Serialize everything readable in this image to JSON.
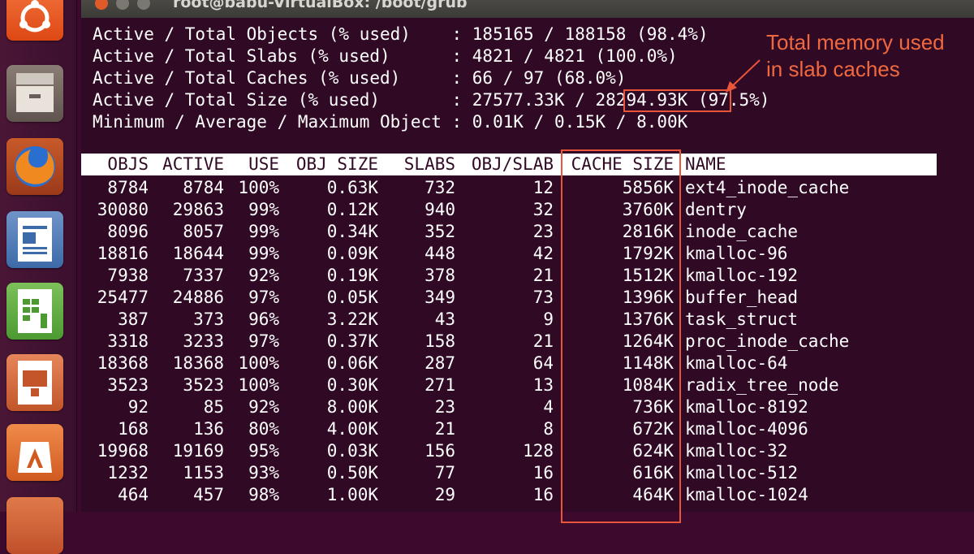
{
  "window": {
    "title": "root@babu-VirtualBox: /boot/grub"
  },
  "launcher": {
    "items": [
      {
        "name": "ubuntu-dash-icon"
      },
      {
        "name": "files-icon"
      },
      {
        "name": "firefox-icon"
      },
      {
        "name": "libreoffice-writer-icon"
      },
      {
        "name": "libreoffice-calc-icon"
      },
      {
        "name": "libreoffice-impress-icon"
      },
      {
        "name": "software-center-icon"
      },
      {
        "name": "launcher-item-icon"
      }
    ]
  },
  "summary": [
    "Active / Total Objects (% used)    : 185165 / 188158 (98.4%)",
    "Active / Total Slabs (% used)      : 4821 / 4821 (100.0%)",
    "Active / Total Caches (% used)     : 66 / 97 (68.0%)",
    "Active / Total Size (% used)       : 27577.33K / 28294.93K (97.5%)",
    "Minimum / Average / Maximum Object : 0.01K / 0.15K / 8.00K"
  ],
  "table": {
    "columns": [
      "OBJS",
      "ACTIVE",
      "USE",
      "OBJ SIZE",
      "SLABS",
      "OBJ/SLAB",
      "CACHE SIZE",
      "NAME"
    ],
    "rows": [
      [
        "8784",
        "8784",
        "100%",
        "0.63K",
        "732",
        "12",
        "5856K",
        "ext4_inode_cache"
      ],
      [
        "30080",
        "29863",
        "99%",
        "0.12K",
        "940",
        "32",
        "3760K",
        "dentry"
      ],
      [
        "8096",
        "8057",
        "99%",
        "0.34K",
        "352",
        "23",
        "2816K",
        "inode_cache"
      ],
      [
        "18816",
        "18644",
        "99%",
        "0.09K",
        "448",
        "42",
        "1792K",
        "kmalloc-96"
      ],
      [
        "7938",
        "7337",
        "92%",
        "0.19K",
        "378",
        "21",
        "1512K",
        "kmalloc-192"
      ],
      [
        "25477",
        "24886",
        "97%",
        "0.05K",
        "349",
        "73",
        "1396K",
        "buffer_head"
      ],
      [
        "387",
        "373",
        "96%",
        "3.22K",
        "43",
        "9",
        "1376K",
        "task_struct"
      ],
      [
        "3318",
        "3233",
        "97%",
        "0.37K",
        "158",
        "21",
        "1264K",
        "proc_inode_cache"
      ],
      [
        "18368",
        "18368",
        "100%",
        "0.06K",
        "287",
        "64",
        "1148K",
        "kmalloc-64"
      ],
      [
        "3523",
        "3523",
        "100%",
        "0.30K",
        "271",
        "13",
        "1084K",
        "radix_tree_node"
      ],
      [
        "92",
        "85",
        "92%",
        "8.00K",
        "23",
        "4",
        "736K",
        "kmalloc-8192"
      ],
      [
        "168",
        "136",
        "80%",
        "4.00K",
        "21",
        "8",
        "672K",
        "kmalloc-4096"
      ],
      [
        "19968",
        "19169",
        "95%",
        "0.03K",
        "156",
        "128",
        "624K",
        "kmalloc-32"
      ],
      [
        "1232",
        "1153",
        "93%",
        "0.50K",
        "77",
        "16",
        "616K",
        "kmalloc-512"
      ],
      [
        "464",
        "457",
        "98%",
        "1.00K",
        "29",
        "16",
        "464K",
        "kmalloc-1024"
      ]
    ]
  },
  "annotation": {
    "text": "Total memory used\nin slab caches",
    "color": "#e8553a"
  }
}
